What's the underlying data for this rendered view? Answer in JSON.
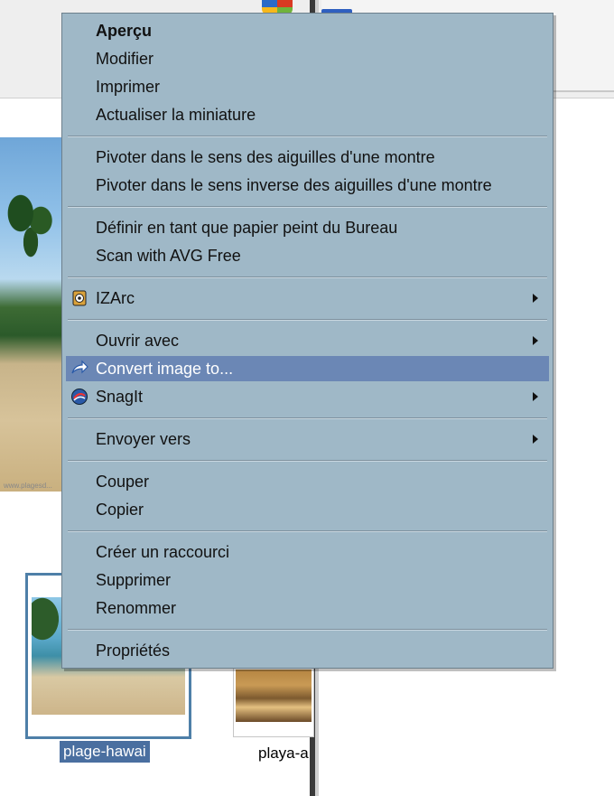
{
  "menu": {
    "groups": [
      [
        "Aperçu",
        "Modifier",
        "Imprimer",
        "Actualiser la miniature"
      ],
      [
        "Pivoter dans le sens des aiguilles d'une montre",
        "Pivoter dans le sens inverse des aiguilles d'une montre"
      ],
      [
        "Définir en tant que papier peint du Bureau",
        "Scan with AVG Free"
      ],
      [
        "IZArc"
      ],
      [
        "Ouvrir avec",
        "Convert image to...",
        "SnagIt"
      ],
      [
        "Envoyer vers"
      ],
      [
        "Couper",
        "Copier"
      ],
      [
        "Créer un raccourci",
        "Supprimer",
        "Renommer"
      ],
      [
        "Propriétés"
      ]
    ],
    "default_item": "Aperçu",
    "highlighted_item": "Convert image to...",
    "submenu_items": [
      "IZArc",
      "Ouvrir avec",
      "SnagIt",
      "Envoyer vers"
    ],
    "item_icons": {
      "IZArc": "izarc-icon",
      "Convert image to...": "convert-arrow-icon",
      "SnagIt": "snagit-icon"
    },
    "colors": {
      "background": "#9fb8c7",
      "highlight": "#6b87b5",
      "highlight_text": "#ffffff"
    }
  },
  "files": [
    {
      "name": "plage-hawai",
      "selected": true
    },
    {
      "name": "playa-a",
      "selected": false
    }
  ]
}
